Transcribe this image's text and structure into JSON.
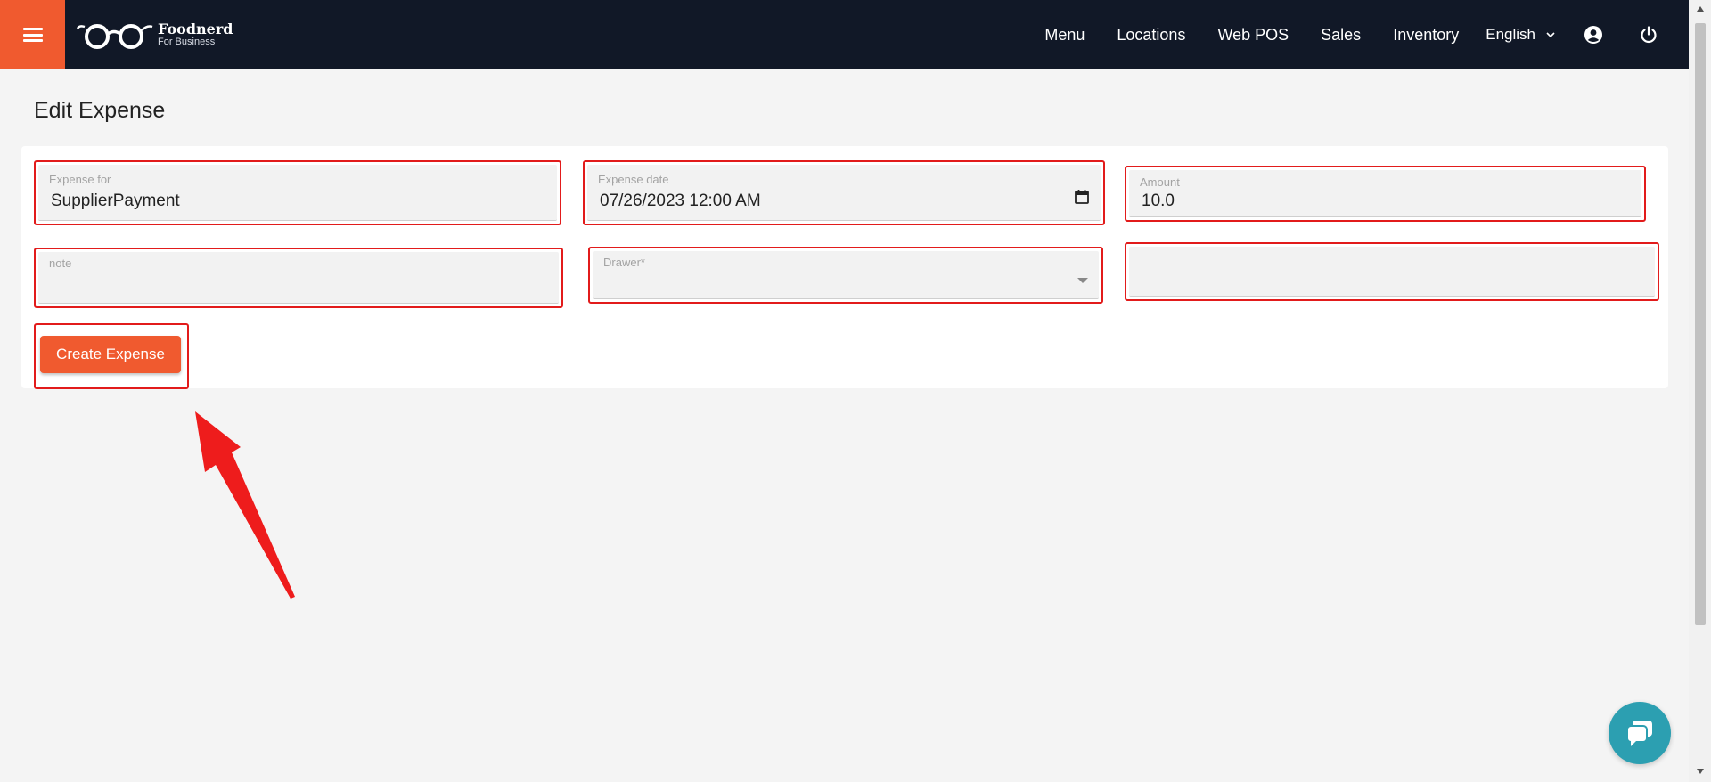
{
  "brand": {
    "name": "Foodnerd",
    "subtitle": "For Business"
  },
  "nav": {
    "items": [
      "Menu",
      "Locations",
      "Web POS",
      "Sales",
      "Inventory"
    ],
    "language": "English"
  },
  "page": {
    "title": "Edit Expense"
  },
  "form": {
    "expense_for": {
      "label": "Expense for",
      "value": "SupplierPayment"
    },
    "expense_date": {
      "label": "Expense date",
      "value": "07/26/2023 12:00 AM"
    },
    "amount": {
      "label": "Amount",
      "value": "10.0"
    },
    "note": {
      "label": "note",
      "value": ""
    },
    "drawer": {
      "label": "Drawer*",
      "value": ""
    },
    "extra": {
      "label": "",
      "value": ""
    },
    "submit_label": "Create Expense"
  },
  "colors": {
    "accent": "#f05a2f",
    "topbar": "#111827",
    "highlight": "#e21b1b",
    "chat": "#2c9fb1"
  },
  "icons": [
    "menu-icon",
    "glasses-logo-icon",
    "chevron-down-icon",
    "account-icon",
    "power-icon",
    "calendar-icon",
    "dropdown-caret-icon",
    "chat-icon"
  ]
}
